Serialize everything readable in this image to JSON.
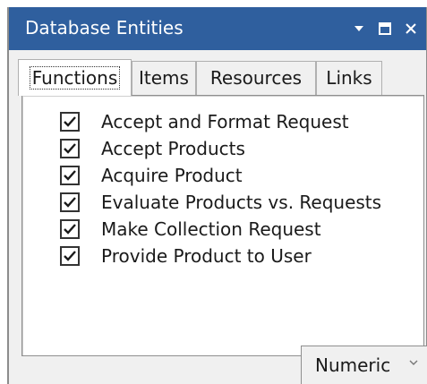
{
  "window": {
    "title": "Database Entities",
    "titlebar_color": "#2f5f9e",
    "icons": [
      "chevron-down-icon",
      "maximize-icon",
      "close-icon"
    ]
  },
  "tabs": [
    {
      "label": "Functions",
      "active": true
    },
    {
      "label": "Items",
      "active": false
    },
    {
      "label": "Resources",
      "active": false
    },
    {
      "label": "Links",
      "active": false
    }
  ],
  "list": {
    "items": [
      {
        "label": "Accept and Format Request",
        "checked": true
      },
      {
        "label": "Accept Products",
        "checked": true
      },
      {
        "label": "Acquire Product",
        "checked": true
      },
      {
        "label": "Evaluate Products vs. Requests",
        "checked": true
      },
      {
        "label": "Make Collection Request",
        "checked": true
      },
      {
        "label": "Provide Product to User",
        "checked": true
      }
    ]
  },
  "sort_select": {
    "value": "Numeric"
  }
}
